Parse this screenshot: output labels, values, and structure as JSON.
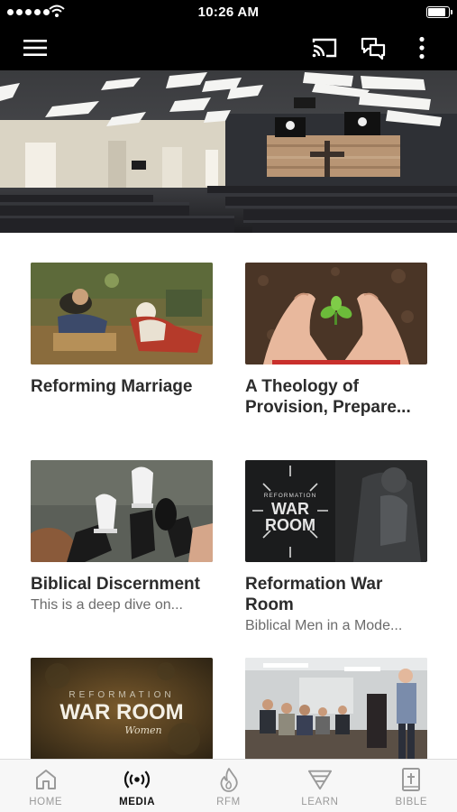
{
  "status_bar": {
    "time": "10:26 AM",
    "signal_bars": 5,
    "battery_level": 0.95
  },
  "header": {
    "menu_icon": "hamburger-menu-icon",
    "cast_icon": "cast-icon",
    "chat_icon": "chat-bubbles-icon",
    "more_icon": "more-vertical-icon"
  },
  "hero": {
    "image": "church-sanctuary-photo"
  },
  "media_items": [
    {
      "title": "Reforming Marriage",
      "subtitle": "",
      "image": "painting-sleeping-couple-thumbnail"
    },
    {
      "title": "A Theology of Provision, Prepare...",
      "subtitle": "",
      "image": "hands-holding-seedling-thumbnail"
    },
    {
      "title": "Biblical Discernment",
      "subtitle": "This is a deep dive on...",
      "image": "sneakers-over-ledge-thumbnail"
    },
    {
      "title": "Reformation War Room",
      "subtitle": "Biblical Men in a Mode...",
      "image": "war-room-armor-thumbnail"
    },
    {
      "title": "",
      "subtitle": "",
      "image": "war-room-women-thumbnail",
      "graphic_text": {
        "top": "REFORMATION",
        "main": "WAR ROOM",
        "script": "Women"
      }
    },
    {
      "title": "",
      "subtitle": "",
      "image": "speaker-classroom-thumbnail"
    }
  ],
  "war_room_logo": {
    "top": "REFORMATION",
    "line1": "WAR",
    "line2": "ROOM"
  },
  "tab_bar": {
    "active": "media",
    "items": [
      {
        "id": "home",
        "label": "HOME",
        "icon": "home-icon"
      },
      {
        "id": "media",
        "label": "MEDIA",
        "icon": "broadcast-icon"
      },
      {
        "id": "rfm",
        "label": "RFM",
        "icon": "flame-icon"
      },
      {
        "id": "learn",
        "label": "LEARN",
        "icon": "funnel-icon"
      },
      {
        "id": "bible",
        "label": "BIBLE",
        "icon": "bible-icon"
      }
    ]
  },
  "colors": {
    "bar_background": "#000000",
    "title_text": "#2c2c2c",
    "subtitle_text": "#6b6b6b",
    "tab_inactive": "#9a9a9a",
    "tab_active": "#111111"
  }
}
